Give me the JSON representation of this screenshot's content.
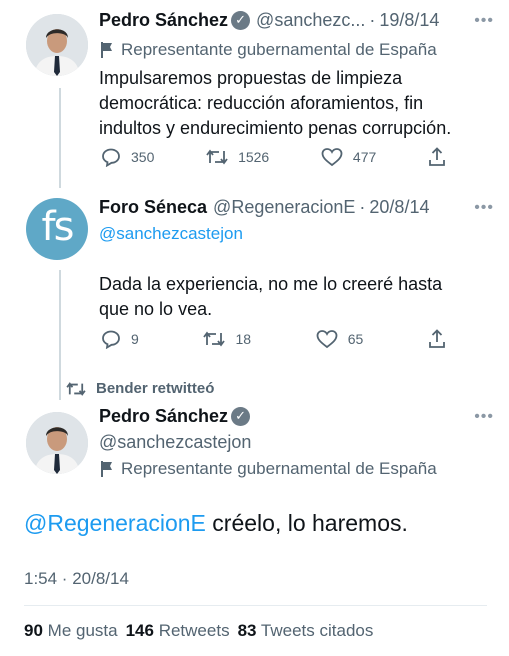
{
  "tweet1": {
    "name": "Pedro Sánchez",
    "handle": "@sanchezc...",
    "date": "19/8/14",
    "label": "Representante gubernamental de España",
    "text": "Impulsaremos propuestas de limpieza\ndemocrática: reducción aforamientos, fin\nindultos y endurecimiento penas corrupción.",
    "replies": "350",
    "retweets": "1526",
    "likes": "477"
  },
  "tweet2": {
    "avatar_text": "fs",
    "name": "Foro Séneca",
    "handle": "@RegeneracionE",
    "date": "20/8/14",
    "reply_to": "@sanchezcastejon",
    "text": "Dada la experiencia, no me lo creeré hasta\nque no lo vea.",
    "replies": "9",
    "retweets": "18",
    "likes": "65"
  },
  "retweet_notice": "Bender retwitteó",
  "tweet3": {
    "name": "Pedro Sánchez",
    "handle": "@sanchezcastejon",
    "label": "Representante gubernamental de España",
    "mention": "@RegeneracionE",
    "text": "créelo, lo haremos.",
    "timestamp": "1:54 · 20/8/14",
    "likes_count": "90",
    "likes_label": "Me gusta",
    "retweets_count": "146",
    "retweets_label": "Retweets",
    "quotes_count": "83",
    "quotes_label": "Tweets citados"
  },
  "colors": {
    "accent": "#1d9bf0",
    "secondary_text": "#536471",
    "fs_avatar": "#5fa8c7"
  },
  "icons": [
    "verified-badge-icon",
    "flag-icon",
    "reply-icon",
    "retweet-icon",
    "like-icon",
    "share-icon",
    "more-icon"
  ]
}
